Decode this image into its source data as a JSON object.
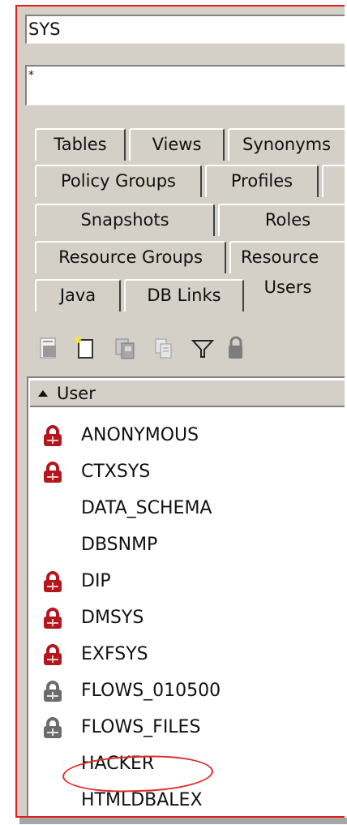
{
  "schema_combo": {
    "value": "SYS"
  },
  "object_filter": {
    "value": "*"
  },
  "tab_rows": [
    [
      "Tables",
      "Views",
      "Synonyms"
    ],
    [
      "Policy Groups",
      "Profiles"
    ],
    [
      "Snapshots",
      "Roles"
    ],
    [
      "Resource Groups",
      "Resource"
    ],
    [
      "Java",
      "DB Links",
      "Users"
    ]
  ],
  "active_tab": "Users",
  "toolbar_icons": [
    "properties-icon",
    "new-object-icon",
    "copy-object-icon",
    "clone-icon",
    "filter-icon",
    "lock-icon"
  ],
  "list": {
    "column_header": "User",
    "sort": "ascending",
    "rows": [
      {
        "name": "ANONYMOUS",
        "icon": "locked-red-icon"
      },
      {
        "name": "CTXSYS",
        "icon": "locked-red-icon"
      },
      {
        "name": "DATA_SCHEMA",
        "icon": "none"
      },
      {
        "name": "DBSNMP",
        "icon": "none"
      },
      {
        "name": "DIP",
        "icon": "locked-red-icon"
      },
      {
        "name": "DMSYS",
        "icon": "locked-red-icon"
      },
      {
        "name": "EXFSYS",
        "icon": "locked-red-icon"
      },
      {
        "name": "FLOWS_010500",
        "icon": "locked-gray-icon"
      },
      {
        "name": "FLOWS_FILES",
        "icon": "locked-gray-icon"
      },
      {
        "name": "HACKER",
        "icon": "none",
        "highlighted": true
      },
      {
        "name": "HTMLDBALEX",
        "icon": "none"
      }
    ]
  },
  "colors": {
    "frame_border": "#e21d1d",
    "lock_red": "#b3171d",
    "lock_gray": "#6c6c6c",
    "highlight_circle": "#e02b2b"
  }
}
